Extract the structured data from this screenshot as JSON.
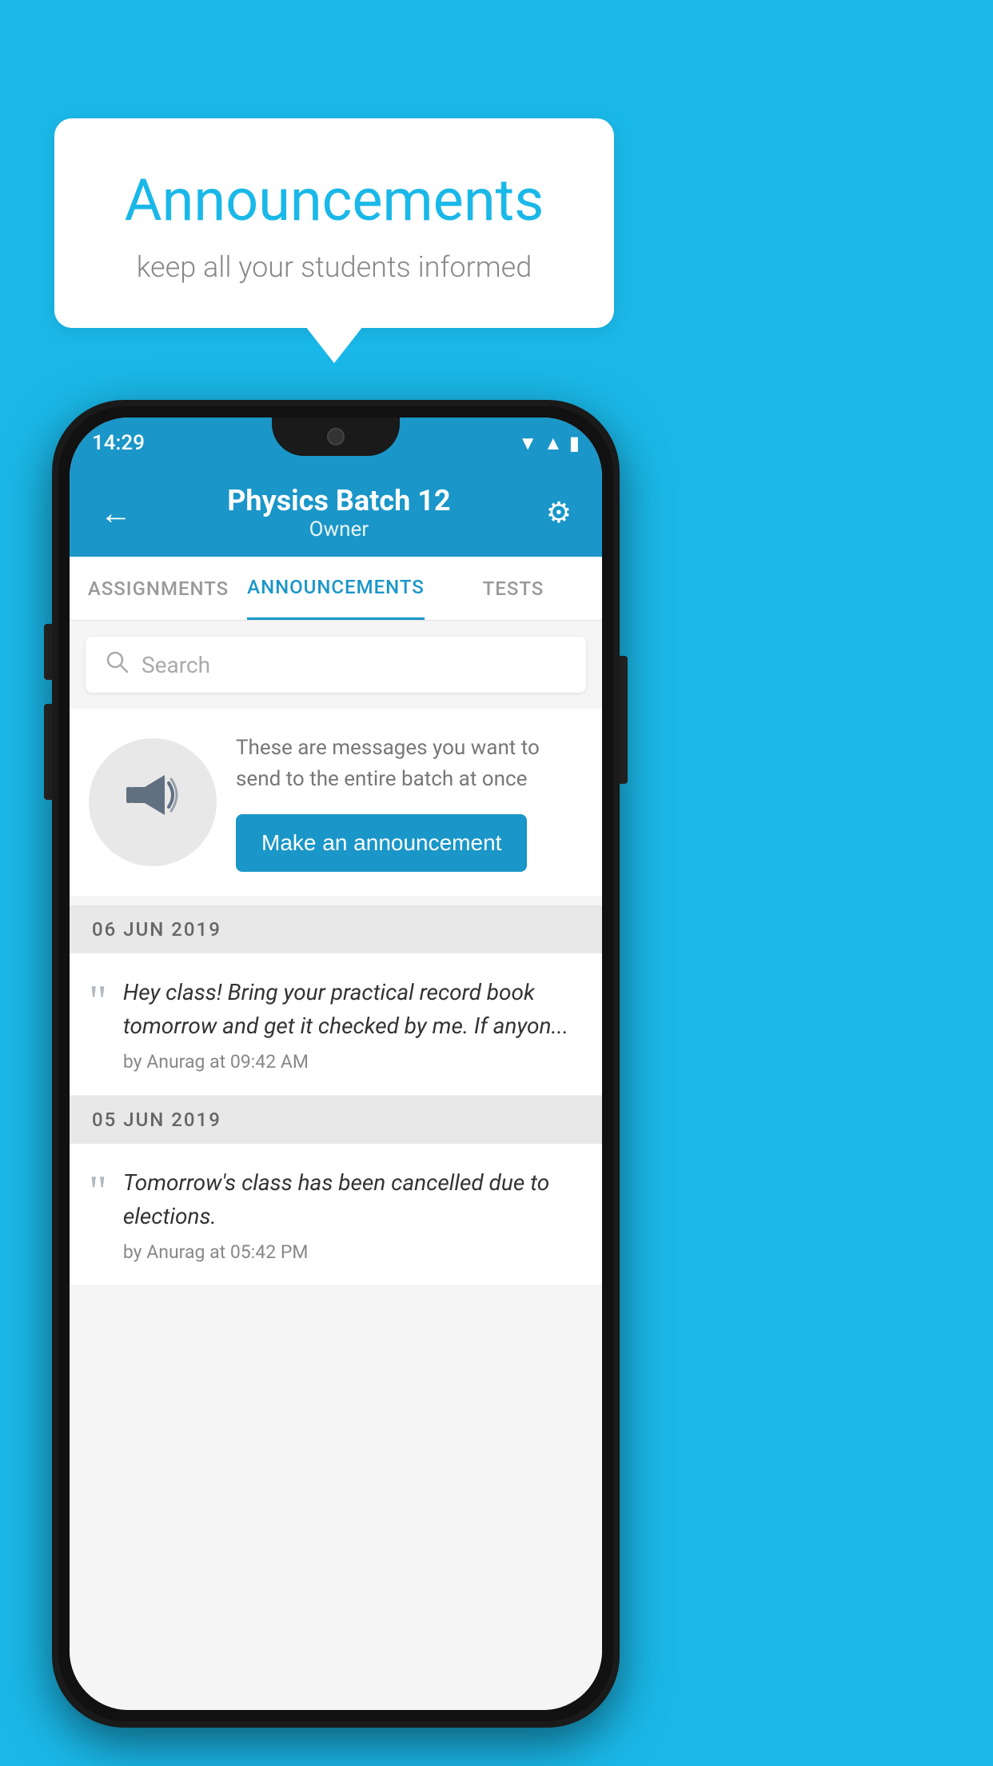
{
  "bubble": {
    "title": "Announcements",
    "subtitle": "keep all your students informed"
  },
  "statusBar": {
    "time": "14:29"
  },
  "appBar": {
    "title": "Physics Batch 12",
    "subtitle": "Owner",
    "backLabel": "←",
    "settingsLabel": "⚙"
  },
  "tabs": [
    {
      "label": "ASSIGNMENTS",
      "active": false
    },
    {
      "label": "ANNOUNCEMENTS",
      "active": true
    },
    {
      "label": "TESTS",
      "active": false
    }
  ],
  "search": {
    "placeholder": "Search"
  },
  "promo": {
    "description": "These are messages you want to send to the entire batch at once",
    "buttonLabel": "Make an announcement"
  },
  "announcements": [
    {
      "date": "06  JUN  2019",
      "text": "Hey class! Bring your practical record book tomorrow and get it checked by me. If anyon...",
      "meta": "by Anurag at 09:42 AM"
    },
    {
      "date": "05  JUN  2019",
      "text": "Tomorrow's class has been cancelled due to elections.",
      "meta": "by Anurag at 05:42 PM"
    }
  ]
}
